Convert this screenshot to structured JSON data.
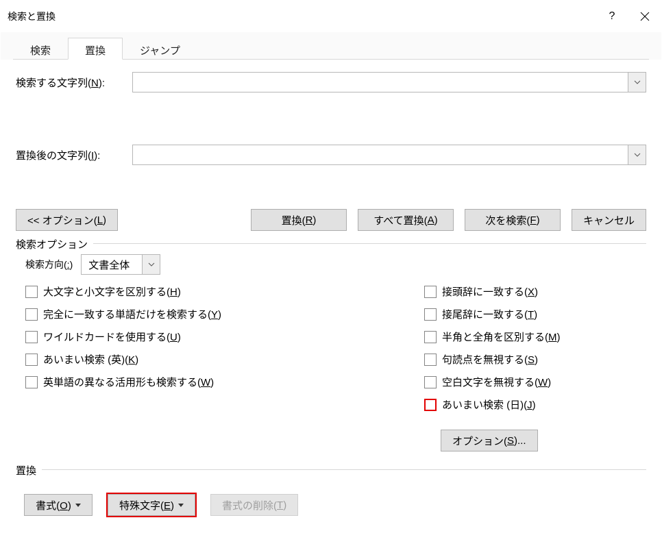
{
  "title": "検索と置換",
  "tabs": {
    "search": "検索",
    "replace": "置換",
    "jump": "ジャンプ"
  },
  "fields": {
    "find_label": "検索する文字列(N):",
    "replace_label": "置換後の文字列(I):",
    "find_value": "",
    "replace_value": ""
  },
  "buttons": {
    "options_toggle": "<< オプション(L)",
    "replace": "置換(R)",
    "replace_all": "すべて置換(A)",
    "find_next": "次を検索(F)",
    "cancel": "キャンセル"
  },
  "options_group": {
    "title": "検索オプション",
    "direction_label": "検索方向(:)",
    "direction_value": "文書全体",
    "left": [
      "大文字と小文字を区別する(H)",
      "完全に一致する単語だけを検索する(Y)",
      "ワイルドカードを使用する(U)",
      "あいまい検索 (英)(K)",
      "英単語の異なる活用形も検索する(W)"
    ],
    "right": [
      "接頭辞に一致する(X)",
      "接尾辞に一致する(T)",
      "半角と全角を区別する(M)",
      "句読点を無視する(S)",
      "空白文字を無視する(W)",
      "あいまい検索 (日)(J)"
    ],
    "more_button": "オプション(S)..."
  },
  "replace_group": {
    "title": "置換",
    "format": "書式(O)",
    "special": "特殊文字(E)",
    "clear_format": "書式の削除(T)"
  }
}
